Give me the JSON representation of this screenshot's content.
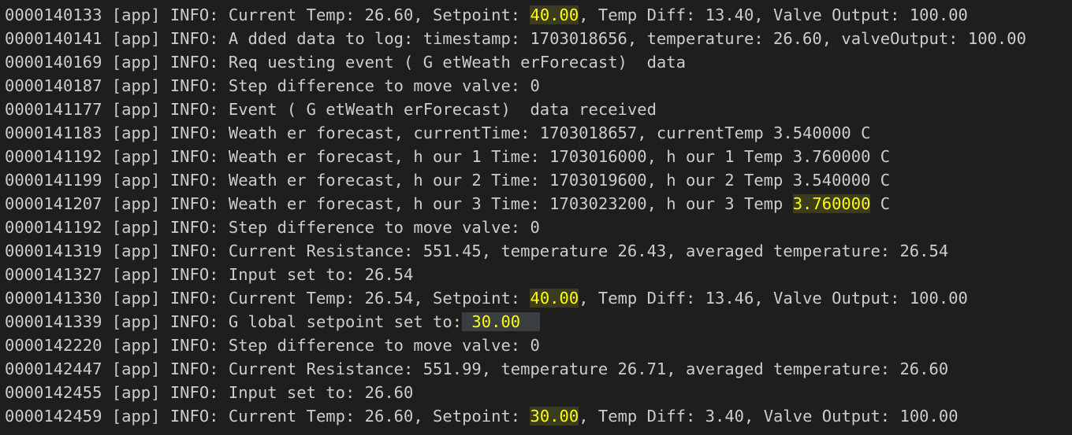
{
  "theme": {
    "background": "#1e1e1e",
    "text": "#cccccc",
    "highlight_text": "#ffff00",
    "highlight_bg": "#3b3b1e",
    "selection_bg": "#3a3d41"
  },
  "log_lines": [
    {
      "segments": [
        {
          "text": "0000140133 [app] INFO: Current Temp: 26.60, Setpoint: "
        },
        {
          "text": "40.00",
          "hl": "yellow"
        },
        {
          "text": ", Temp Diff: 13.40, Valve Output: 100.00"
        }
      ]
    },
    {
      "segments": [
        {
          "text": "0000140141 [app] INFO: A dded data to log: timestamp: 1703018656, temperature: 26.60, valveOutput: 100.00"
        }
      ]
    },
    {
      "segments": [
        {
          "text": "0000140169 [app] INFO: Req uesting event ( G etWeath erForecast)  data"
        }
      ]
    },
    {
      "segments": [
        {
          "text": "0000140187 [app] INFO: Step difference to move valve: 0"
        }
      ]
    },
    {
      "segments": [
        {
          "text": "0000141177 [app] INFO: Event ( G etWeath erForecast)  data received"
        }
      ]
    },
    {
      "segments": [
        {
          "text": "0000141183 [app] INFO: Weath er forecast, currentTime: 1703018657, currentTemp 3.540000 C"
        }
      ]
    },
    {
      "segments": [
        {
          "text": "0000141192 [app] INFO: Weath er forecast, h our 1 Time: 1703016000, h our 1 Temp 3.760000 C"
        }
      ]
    },
    {
      "segments": [
        {
          "text": "0000141199 [app] INFO: Weath er forecast, h our 2 Time: 1703019600, h our 2 Temp 3.540000 C"
        }
      ]
    },
    {
      "segments": [
        {
          "text": "0000141207 [app] INFO: Weath er forecast, h our 3 Time: 1703023200, h our 3 Temp "
        },
        {
          "text": "3.760000",
          "hl": "yellow"
        },
        {
          "text": " C"
        }
      ]
    },
    {
      "segments": [
        {
          "text": "0000141192 [app] INFO: Step difference to move valve: 0"
        }
      ]
    },
    {
      "segments": [
        {
          "text": "0000141319 [app] INFO: Current Resistance: 551.45, temperature 26.43, averaged temperature: 26.54"
        }
      ]
    },
    {
      "segments": [
        {
          "text": "0000141327 [app] INFO: Input set to: 26.54"
        }
      ]
    },
    {
      "segments": [
        {
          "text": "0000141330 [app] INFO: Current Temp: 26.54, Setpoint: "
        },
        {
          "text": "40.00",
          "hl": "yellow"
        },
        {
          "text": ", Temp Diff: 13.46, Valve Output: 100.00"
        }
      ]
    },
    {
      "segments": [
        {
          "text": "0000141339 [app] INFO: G lobal setpoint set to:"
        },
        {
          "text": " 30.00  ",
          "hl": "sel"
        }
      ]
    },
    {
      "segments": [
        {
          "text": "0000142220 [app] INFO: Step difference to move valve: 0"
        }
      ]
    },
    {
      "segments": [
        {
          "text": "0000142447 [app] INFO: Current Resistance: 551.99, temperature 26.71, averaged temperature: 26.60"
        }
      ]
    },
    {
      "segments": [
        {
          "text": "0000142455 [app] INFO: Input set to: 26.60"
        }
      ]
    },
    {
      "segments": [
        {
          "text": "0000142459 [app] INFO: Current Temp: 26.60, Setpoint: "
        },
        {
          "text": "30.00",
          "hl": "yellow"
        },
        {
          "text": ", Temp Diff: 3.40, Valve Output: 100.00"
        }
      ]
    }
  ]
}
